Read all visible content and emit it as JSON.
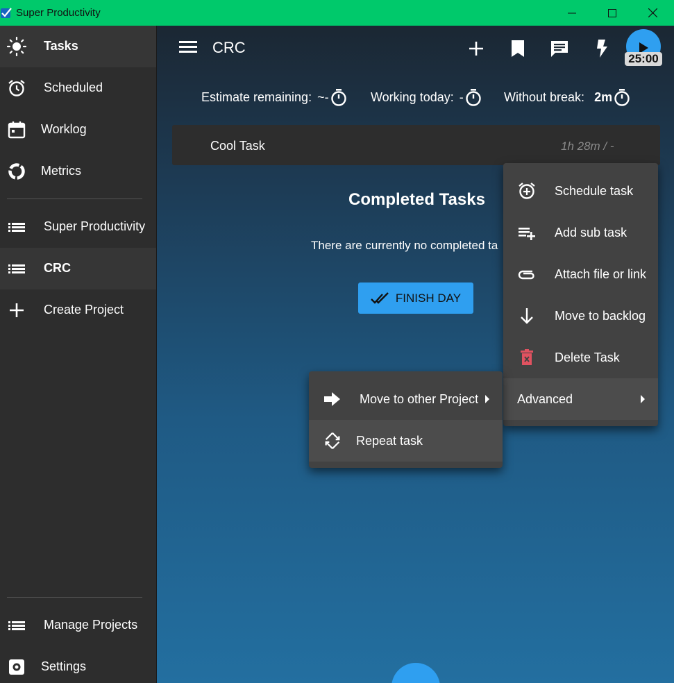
{
  "window": {
    "title": "Super Productivity",
    "controls": [
      "minimize",
      "maximize",
      "close"
    ]
  },
  "sidebar": {
    "items": [
      {
        "label": "Tasks",
        "icon": "sun-icon",
        "active": true
      },
      {
        "label": "Scheduled",
        "icon": "alarm-icon"
      },
      {
        "label": "Worklog",
        "icon": "calendar-icon"
      },
      {
        "label": "Metrics",
        "icon": "donut-chart-icon"
      }
    ],
    "projects": [
      {
        "label": "Super Productivity",
        "icon": "list-icon"
      },
      {
        "label": "CRC",
        "icon": "list-icon",
        "active": true
      },
      {
        "label": "Create Project",
        "icon": "plus-icon"
      }
    ],
    "footer": [
      {
        "label": "Manage Projects",
        "icon": "list-icon"
      },
      {
        "label": "Settings",
        "icon": "gear-icon"
      }
    ]
  },
  "header": {
    "title": "CRC",
    "timer": "25:00"
  },
  "stats": {
    "estimate_label": "Estimate remaining:",
    "estimate_value": "~-",
    "working_label": "Working today:",
    "working_value": "-",
    "break_label": "Without break:",
    "break_value": "2m"
  },
  "task": {
    "name": "Cool Task",
    "time": "1h 28m / -"
  },
  "completed": {
    "heading": "Completed Tasks",
    "empty_text": "There are currently no completed ta",
    "finish_button": "FINISH DAY"
  },
  "context_menu": {
    "items": [
      {
        "label": "Schedule task",
        "icon": "alarm-add-icon"
      },
      {
        "label": "Add sub task",
        "icon": "playlist-add-icon"
      },
      {
        "label": "Attach file or link",
        "icon": "attachment-icon"
      },
      {
        "label": "Move to backlog",
        "icon": "arrow-down-icon"
      },
      {
        "label": "Delete Task",
        "icon": "delete-icon",
        "color": "#e05260"
      },
      {
        "label": "Advanced",
        "submenu": true
      }
    ]
  },
  "sub_menu": {
    "items": [
      {
        "label": "Move to other Project",
        "icon": "arrow-right-icon",
        "submenu": true
      },
      {
        "label": "Repeat task",
        "icon": "repeat-icon"
      }
    ]
  },
  "colors": {
    "titlebar": "#00c96b",
    "accent": "#2f9ff0",
    "sidebar": "#2d2d2d",
    "menu": "#424242",
    "delete": "#e05260"
  }
}
